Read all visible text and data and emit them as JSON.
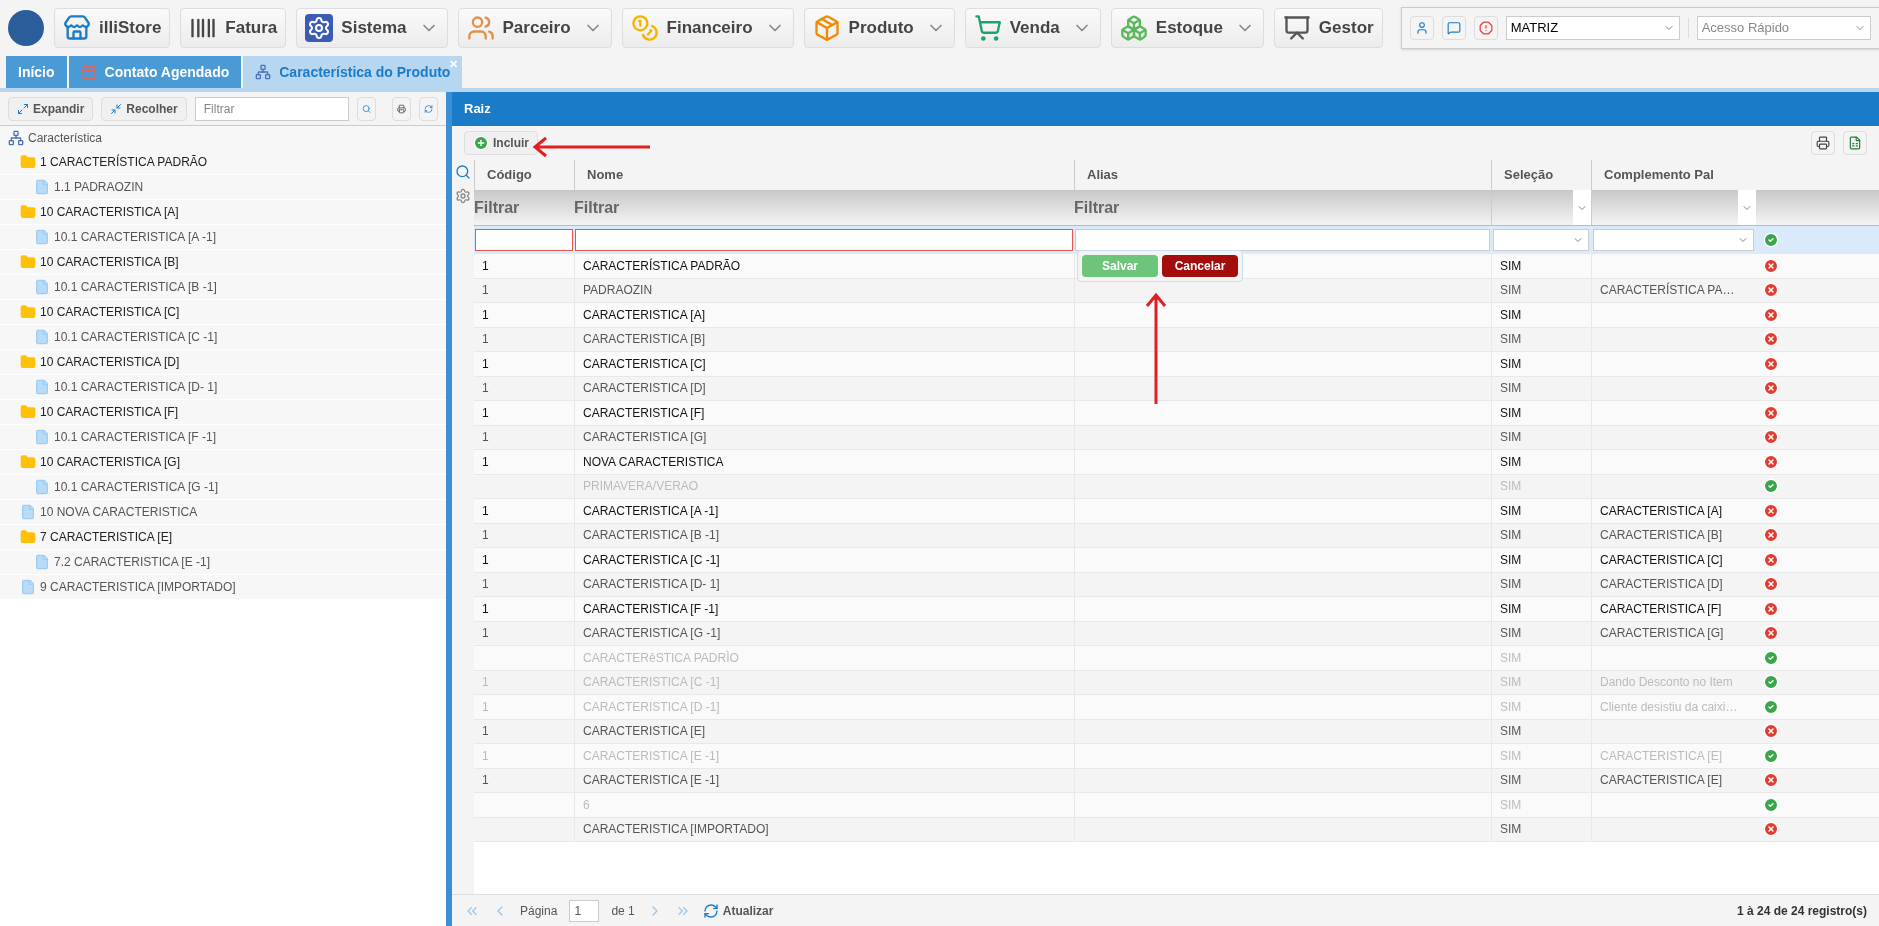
{
  "nav": [
    {
      "label": "illiStore",
      "dropdown": false
    },
    {
      "label": "Fatura",
      "dropdown": false
    },
    {
      "label": "Sistema",
      "dropdown": true
    },
    {
      "label": "Parceiro",
      "dropdown": true
    },
    {
      "label": "Financeiro",
      "dropdown": true
    },
    {
      "label": "Produto",
      "dropdown": true
    },
    {
      "label": "Venda",
      "dropdown": true
    },
    {
      "label": "Estoque",
      "dropdown": true
    },
    {
      "label": "Gestor",
      "dropdown": false
    }
  ],
  "quick": {
    "branch": "MATRIZ",
    "quick_access_placeholder": "Acesso Rápido"
  },
  "tabs": [
    {
      "label": "Início",
      "selected": false
    },
    {
      "label": "Contato Agendado",
      "selected": false
    },
    {
      "label": "Característica do Produto",
      "selected": true,
      "close": "✕"
    }
  ],
  "tree_toolbar": {
    "expand": "Expandir",
    "collapse": "Recolher",
    "filter_placeholder": "Filtrar"
  },
  "tree": {
    "label": "Característica",
    "children": [
      {
        "label": "1 CARACTERÍSTICA PADRÃO",
        "kind": "folder",
        "children": [
          {
            "label": "1.1 PADRAOZIN",
            "kind": "file"
          }
        ]
      },
      {
        "label": "10 CARACTERISTICA [A]",
        "kind": "folder",
        "children": [
          {
            "label": "10.1 CARACTERISTICA [A -1]",
            "kind": "file"
          }
        ]
      },
      {
        "label": "10 CARACTERISTICA [B]",
        "kind": "folder",
        "children": [
          {
            "label": "10.1 CARACTERISTICA [B -1]",
            "kind": "file"
          }
        ]
      },
      {
        "label": "10 CARACTERISTICA [C]",
        "kind": "folder",
        "children": [
          {
            "label": "10.1 CARACTERISTICA [C -1]",
            "kind": "file"
          }
        ]
      },
      {
        "label": "10 CARACTERISTICA [D]",
        "kind": "folder",
        "children": [
          {
            "label": "10.1 CARACTERISTICA [D- 1]",
            "kind": "file"
          }
        ]
      },
      {
        "label": "10 CARACTERISTICA [F]",
        "kind": "folder",
        "children": [
          {
            "label": "10.1 CARACTERISTICA [F -1]",
            "kind": "file"
          }
        ]
      },
      {
        "label": "10 CARACTERISTICA [G]",
        "kind": "folder",
        "children": [
          {
            "label": "10.1 CARACTERISTICA [G -1]",
            "kind": "file"
          }
        ]
      },
      {
        "label": "10 NOVA CARACTERISTICA",
        "kind": "file"
      },
      {
        "label": "7 CARACTERISTICA [E]",
        "kind": "folder",
        "children": [
          {
            "label": "7.2 CARACTERISTICA [E -1]",
            "kind": "file"
          }
        ]
      },
      {
        "label": "9 CARACTERISTICA [IMPORTADO]",
        "kind": "file"
      }
    ]
  },
  "panel": {
    "title": "Raiz",
    "add_button": "Incluir",
    "save_button": "Salvar",
    "cancel_button": "Cancelar"
  },
  "table": {
    "columns": [
      "Código",
      "Nome",
      "Alias",
      "Seleção",
      "Complemento Pal"
    ],
    "filter_labels": [
      "Filtrar",
      "Filtrar",
      "Filtrar"
    ],
    "rows": [
      {
        "code": "1",
        "name": "CARACTERÍSTICA PADRÃO",
        "selection": "SIM",
        "complement": "",
        "active": true
      },
      {
        "code": "1",
        "name": "PADRAOZIN",
        "selection": "SIM",
        "complement": "CARACTERÍSTICA PA…",
        "active": true
      },
      {
        "code": "1",
        "name": "CARACTERISTICA [A]",
        "selection": "SIM",
        "complement": "",
        "active": true
      },
      {
        "code": "1",
        "name": "CARACTERISTICA [B]",
        "selection": "SIM",
        "complement": "",
        "active": true
      },
      {
        "code": "1",
        "name": "CARACTERISTICA [C]",
        "selection": "SIM",
        "complement": "",
        "active": true
      },
      {
        "code": "1",
        "name": "CARACTERISTICA [D]",
        "selection": "SIM",
        "complement": "",
        "active": true
      },
      {
        "code": "1",
        "name": "CARACTERISTICA [F]",
        "selection": "SIM",
        "complement": "",
        "active": true
      },
      {
        "code": "1",
        "name": "CARACTERISTICA [G]",
        "selection": "SIM",
        "complement": "",
        "active": true
      },
      {
        "code": "1",
        "name": "NOVA CARACTERISTICA",
        "selection": "SIM",
        "complement": "",
        "active": true
      },
      {
        "code": "",
        "name": "PRIMAVERA/VERAO",
        "selection": "SIM",
        "complement": "",
        "active": false
      },
      {
        "code": "1",
        "name": "CARACTERISTICA [A -1]",
        "selection": "SIM",
        "complement": "CARACTERISTICA [A]",
        "active": true
      },
      {
        "code": "1",
        "name": "CARACTERISTICA [B -1]",
        "selection": "SIM",
        "complement": "CARACTERISTICA [B]",
        "active": true
      },
      {
        "code": "1",
        "name": "CARACTERISTICA [C -1]",
        "selection": "SIM",
        "complement": "CARACTERISTICA [C]",
        "active": true
      },
      {
        "code": "1",
        "name": "CARACTERISTICA [D- 1]",
        "selection": "SIM",
        "complement": "CARACTERISTICA [D]",
        "active": true
      },
      {
        "code": "1",
        "name": "CARACTERISTICA [F -1]",
        "selection": "SIM",
        "complement": "CARACTERISTICA [F]",
        "active": true
      },
      {
        "code": "1",
        "name": "CARACTERISTICA [G -1]",
        "selection": "SIM",
        "complement": "CARACTERISTICA [G]",
        "active": true
      },
      {
        "code": "",
        "name": "CARACTERêSTICA PADRÌO",
        "selection": "SIM",
        "complement": "",
        "active": false
      },
      {
        "code": "1",
        "name": "CARACTERISTICA [C -1]",
        "selection": "SIM",
        "complement": "Dando Desconto no Item",
        "active": false
      },
      {
        "code": "1",
        "name": "CARACTERISTICA [D -1]",
        "selection": "SIM",
        "complement": "Cliente desistiu da caixi…",
        "active": false
      },
      {
        "code": "1",
        "name": "CARACTERISTICA [E]",
        "selection": "SIM",
        "complement": "",
        "active": true
      },
      {
        "code": "1",
        "name": "CARACTERISTICA [E -1]",
        "selection": "SIM",
        "complement": "CARACTERISTICA [E]",
        "active": false
      },
      {
        "code": "1",
        "name": "CARACTERISTICA [E -1]",
        "selection": "SIM",
        "complement": "CARACTERISTICA [E]",
        "active": true
      },
      {
        "code": "",
        "name": "6",
        "selection": "SIM",
        "complement": "",
        "active": false
      },
      {
        "code": "",
        "name": "CARACTERISTICA [IMPORTADO]",
        "selection": "SIM",
        "complement": "",
        "active": true
      }
    ]
  },
  "pager": {
    "page_label": "Página",
    "page": "1",
    "of": "de 1",
    "refresh": "Atualizar",
    "summary": "1 à 24 de 24 registro(s)"
  }
}
